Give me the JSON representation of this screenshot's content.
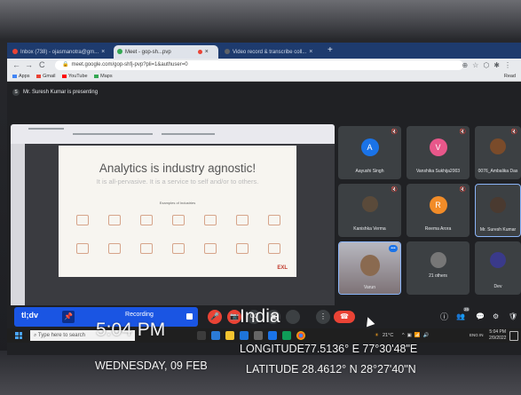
{
  "browser": {
    "tabs": [
      {
        "label": "Inbox (738) - ojasmanotra@gm...",
        "close": "×",
        "color": "#ea4335"
      },
      {
        "label": "Meet - gop-sh...pvp",
        "close": "×",
        "color": "#34a853"
      },
      {
        "label": "Video record & transcribe coll...",
        "close": "×",
        "color": "#5f6368"
      }
    ],
    "new_tab": "+",
    "back": "←",
    "forward": "→",
    "reload": "C",
    "url": "meet.google.com/gop-shfj-pvp?pli=1&authuser=0",
    "bookmarks": [
      "Apps",
      "Gmail",
      "YouTube",
      "Maps"
    ],
    "reading_list": "Read"
  },
  "meet": {
    "presenting_text": "Mr. Suresh Kumar is presenting",
    "slide": {
      "title": "Analytics is industry agnostic!",
      "subtitle": "It is all-pervasive. It is a service to self and/or to others.",
      "caption": "Examples of Industries",
      "logo": "EXL"
    },
    "participants": [
      {
        "name": "Aayushi Singh",
        "initial": "A",
        "color": "#1a73e8"
      },
      {
        "name": "Vanshika Sukhija2003",
        "initial": "V",
        "color": "#e8578a"
      },
      {
        "name": "0076_Ambalika Das",
        "initial": "",
        "color": "#7a4b2a"
      },
      {
        "name": "Kanishka Verma",
        "initial": "",
        "color": "#5a4a3a"
      },
      {
        "name": "Reema Arora",
        "initial": "R",
        "color": "#f28c28"
      },
      {
        "name": "Mr. Suresh Kumar",
        "initial": "",
        "color": "#4a3a30"
      },
      {
        "name": "Varun",
        "initial": "",
        "color": "#8a6a50"
      },
      {
        "name": "21 others",
        "initial": "",
        "color": "#777"
      },
      {
        "name": "Dev",
        "initial": "",
        "color": "#5a5a8a"
      }
    ],
    "controls": {
      "mic": "🎤",
      "camera": "📷",
      "captions": "CC",
      "present": "▣",
      "more": "⋮",
      "hangup": "☎",
      "info": "ⓘ",
      "people": "👥",
      "people_count": "26",
      "chat": "💬",
      "activities": "⚙",
      "host": "🛡"
    }
  },
  "tldv": {
    "logo": "tl;dv",
    "pin": "📌",
    "status": "Recording"
  },
  "taskbar": {
    "search_placeholder": "Type here to search",
    "weather": "21°C",
    "lang": "ENG IN",
    "time": "5:04 PM",
    "date": "2/9/2022"
  },
  "overlay": {
    "time": "5:04 PM",
    "location": "India",
    "longitude": "LONGITUDE77.5136° E 77°30'48\"E",
    "date": "WEDNESDAY, 09 FEB",
    "latitude": "LATITUDE  28.4612° N 28°27'40\"N"
  }
}
